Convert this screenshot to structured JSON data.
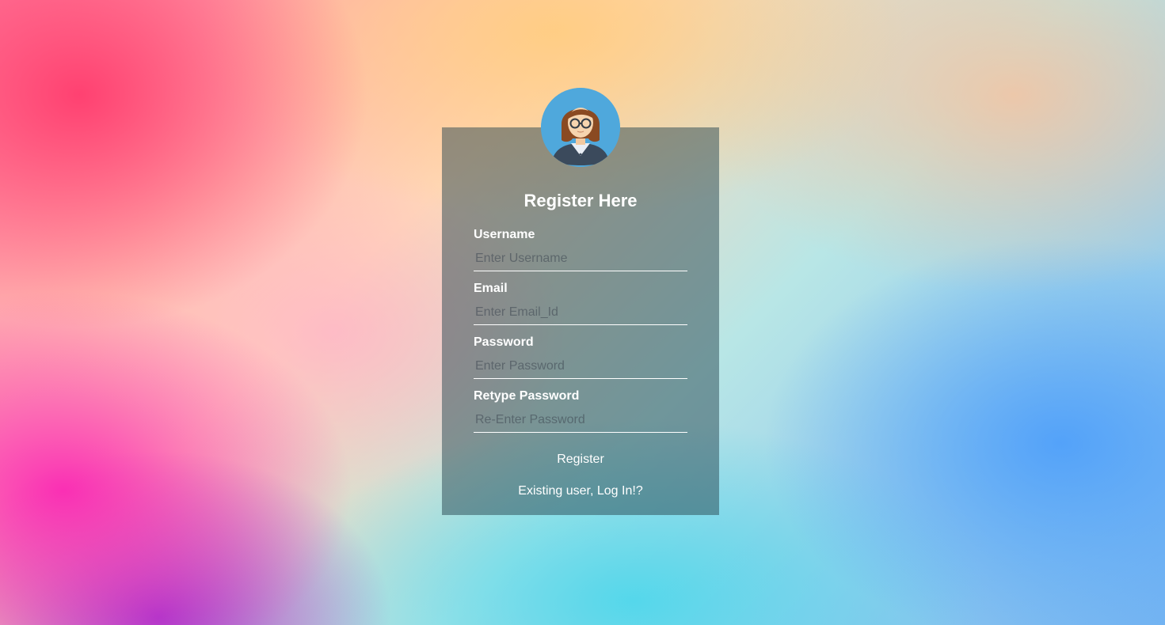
{
  "form": {
    "title": "Register Here",
    "fields": [
      {
        "label": "Username",
        "placeholder": "Enter Username",
        "value": ""
      },
      {
        "label": "Email",
        "placeholder": "Enter Email_Id",
        "value": ""
      },
      {
        "label": "Password",
        "placeholder": "Enter Password",
        "value": ""
      },
      {
        "label": "Retype Password",
        "placeholder": "Re-Enter Password",
        "value": ""
      }
    ],
    "submit_label": "Register",
    "login_link": "Existing user, Log In!?"
  },
  "avatar": {
    "icon": "user-avatar-icon",
    "background_color": "#4fa8dc"
  },
  "colors": {
    "card_overlay": "rgba(40,70,80,0.5)",
    "text": "#ffffff"
  }
}
